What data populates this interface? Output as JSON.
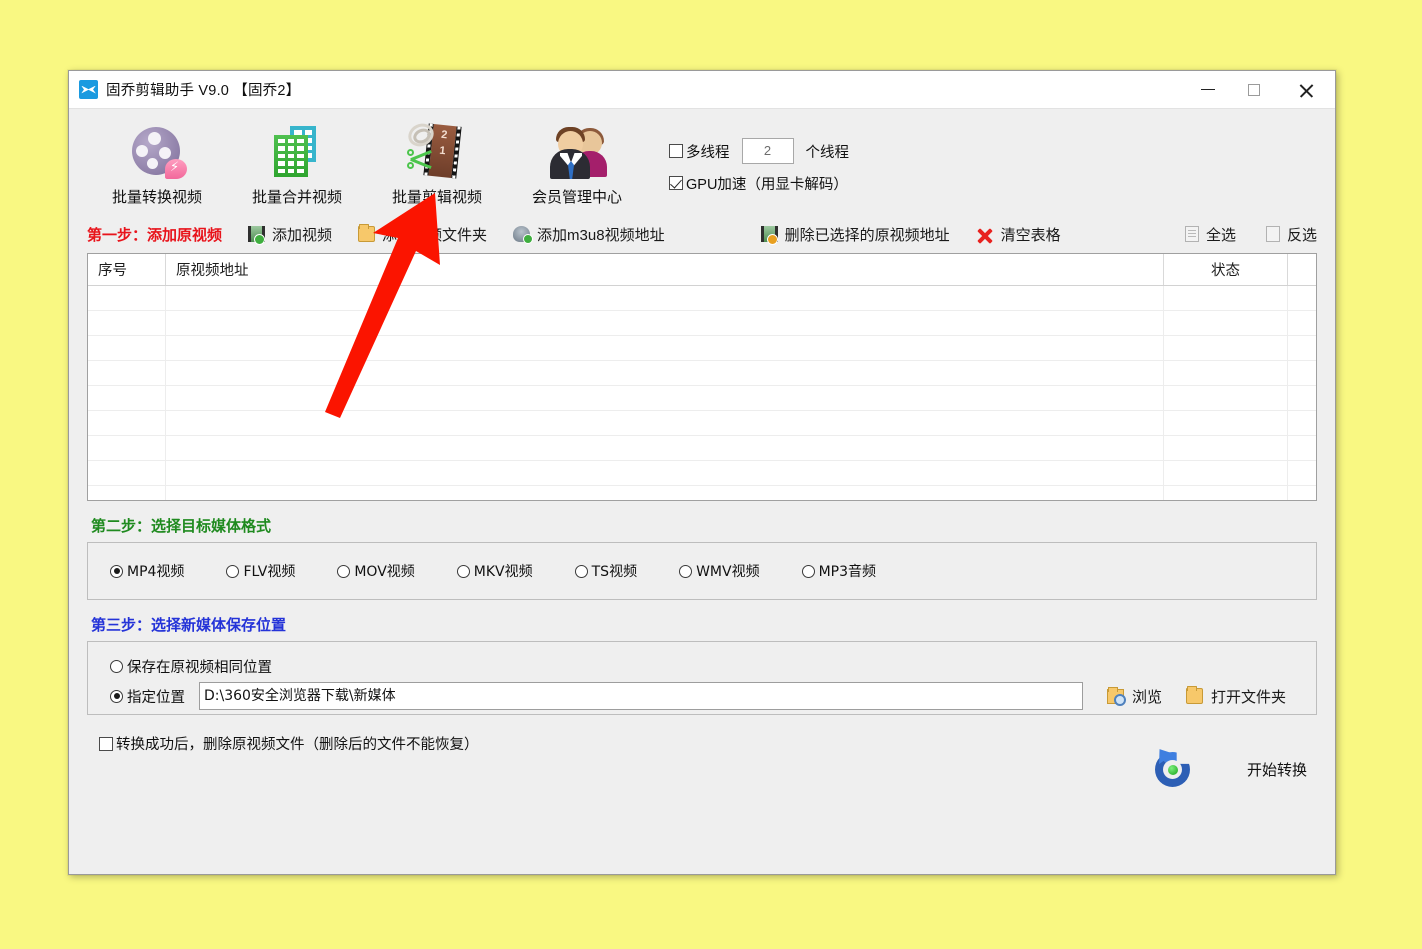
{
  "window": {
    "title": "固乔剪辑助手 V9.0 【固乔2】",
    "app_icon": "scissors-icon",
    "controls": {
      "minimize": "minimize-icon",
      "maximize": "maximize-icon",
      "close": "close-icon"
    }
  },
  "toolbar": {
    "buttons": [
      {
        "label": "批量转换视频",
        "icon": "film-reel-icon"
      },
      {
        "label": "批量合并视频",
        "icon": "green-buildings-icon"
      },
      {
        "label": "批量剪辑视频",
        "icon": "film-scissors-icon"
      },
      {
        "label": "会员管理中心",
        "icon": "members-icon"
      }
    ],
    "multithread": {
      "label": "多线程",
      "checked": false,
      "value": "2",
      "unit_label": "个线程"
    },
    "gpu": {
      "label": "GPU加速（用显卡解码）",
      "checked": true
    }
  },
  "step1": {
    "title": "第一步：添加原视频",
    "title_color": "#e8131b",
    "actions": [
      {
        "label": "添加视频",
        "icon": "add-video-icon"
      },
      {
        "label": "添加视频文件夹",
        "icon": "add-folder-icon"
      },
      {
        "label": "添加m3u8视频地址",
        "icon": "add-m3u8-icon"
      },
      {
        "label": "删除已选择的原视频地址",
        "icon": "delete-video-icon"
      },
      {
        "label": "清空表格",
        "icon": "clear-table-icon"
      }
    ],
    "right_actions": [
      {
        "label": "全选",
        "icon": "select-all-icon"
      },
      {
        "label": "反选",
        "icon": "invert-select-icon"
      }
    ],
    "table": {
      "columns": [
        "序号",
        "原视频地址",
        "状态"
      ],
      "rows": [],
      "empty_row_count": 9
    }
  },
  "step2": {
    "title": "第二步：选择目标媒体格式",
    "title_color": "#1f8a1f",
    "formats": [
      {
        "label": "MP4视频",
        "selected": true
      },
      {
        "label": "FLV视频",
        "selected": false
      },
      {
        "label": "MOV视频",
        "selected": false
      },
      {
        "label": "MKV视频",
        "selected": false
      },
      {
        "label": "TS视频",
        "selected": false
      },
      {
        "label": "WMV视频",
        "selected": false
      },
      {
        "label": "MP3音频",
        "selected": false
      }
    ]
  },
  "step3": {
    "title": "第三步：选择新媒体保存位置",
    "title_color": "#2433d8",
    "same_location": {
      "label": "保存在原视频相同位置",
      "selected": false
    },
    "custom_location": {
      "label": "指定位置",
      "selected": true
    },
    "path_value": "D:\\360安全浏览器下载\\新媒体",
    "browse_button": {
      "label": "浏览",
      "icon": "browse-folder-icon"
    },
    "open_folder_button": {
      "label": "打开文件夹",
      "icon": "open-folder-icon"
    }
  },
  "bottom": {
    "delete_source": {
      "label": "转换成功后，删除原视频文件（删除后的文件不能恢复）",
      "checked": false
    },
    "start_button": {
      "label": "开始转换",
      "icon": "refresh-circle-icon"
    }
  },
  "annotation": {
    "arrow_color": "#fb1400",
    "points_to": "批量剪辑视频"
  }
}
